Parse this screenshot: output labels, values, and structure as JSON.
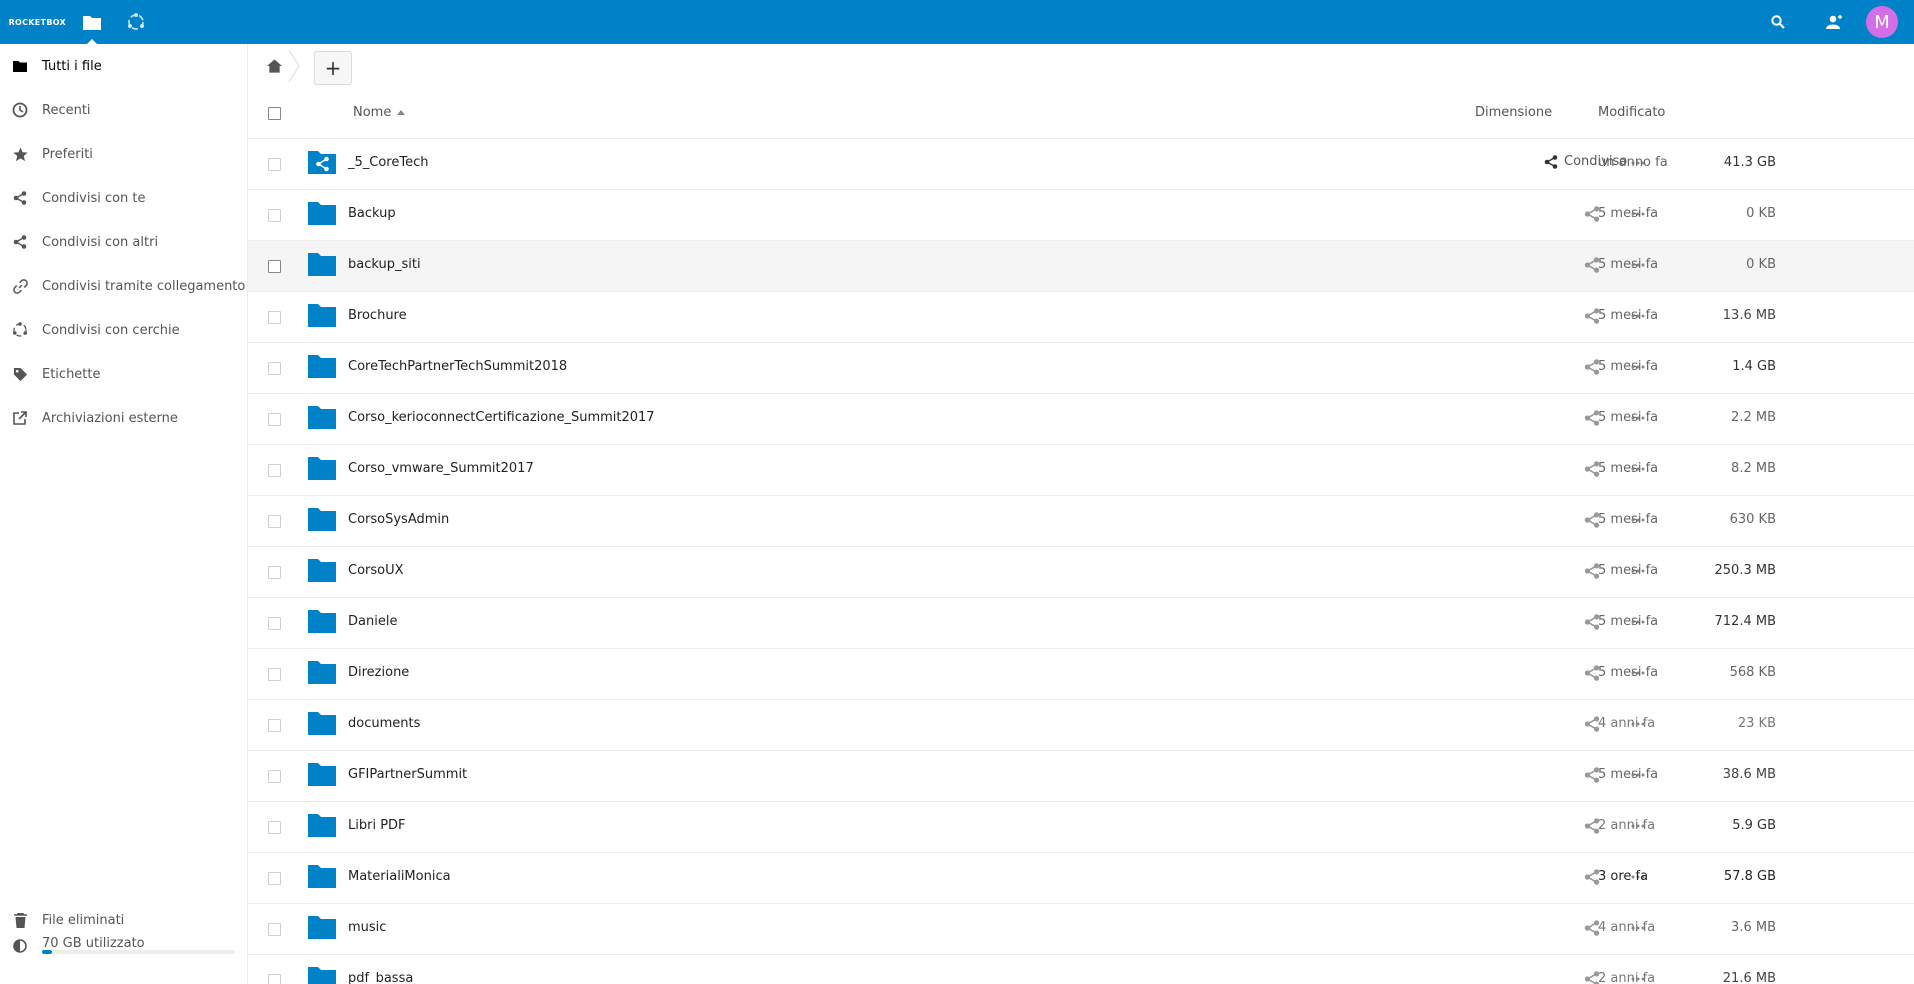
{
  "header": {
    "logo_text": "ROCKETBOX",
    "avatar_initial": "M",
    "brand_color": "#0082c9",
    "icons": [
      "folder-icon",
      "circles-icon",
      "search-icon",
      "contacts-icon"
    ]
  },
  "sidebar": {
    "items": [
      {
        "label": "Tutti i file",
        "icon": "folder-icon"
      },
      {
        "label": "Recenti",
        "icon": "clock-icon"
      },
      {
        "label": "Preferiti",
        "icon": "star-icon"
      },
      {
        "label": "Condivisi con te",
        "icon": "share-icon"
      },
      {
        "label": "Condivisi con altri",
        "icon": "share-icon"
      },
      {
        "label": "Condivisi tramite collegamento",
        "icon": "link-icon"
      },
      {
        "label": "Condivisi con cerchie",
        "icon": "circles-icon"
      },
      {
        "label": "Etichette",
        "icon": "tag-icon"
      },
      {
        "label": "Archiviazioni esterne",
        "icon": "external-icon"
      }
    ],
    "trash_label": "File eliminati",
    "quota_label": "70 GB utilizzato",
    "quota_fraction": 0.05
  },
  "table": {
    "columns": {
      "name": "Nome",
      "size": "Dimensione",
      "modified": "Modificato"
    },
    "shared_label": "Condiviso",
    "rows": [
      {
        "name": "_5_CoreTech",
        "size": "41.3 GB",
        "modified": "un anno fa",
        "shared": true
      },
      {
        "name": "Backup",
        "size": "0 KB",
        "modified": "5 mesi fa"
      },
      {
        "name": "backup_siti",
        "size": "0 KB",
        "modified": "5 mesi fa"
      },
      {
        "name": "Brochure",
        "size": "13.6 MB",
        "modified": "5 mesi fa"
      },
      {
        "name": "CoreTechPartnerTechSummit2018",
        "size": "1.4 GB",
        "modified": "5 mesi fa"
      },
      {
        "name": "Corso_kerioconnectCertificazione_Summit2017",
        "size": "2.2 MB",
        "modified": "5 mesi fa"
      },
      {
        "name": "Corso_vmware_Summit2017",
        "size": "8.2 MB",
        "modified": "5 mesi fa"
      },
      {
        "name": "CorsoSysAdmin",
        "size": "630 KB",
        "modified": "5 mesi fa"
      },
      {
        "name": "CorsoUX",
        "size": "250.3 MB",
        "modified": "5 mesi fa"
      },
      {
        "name": "Daniele",
        "size": "712.4 MB",
        "modified": "5 mesi fa"
      },
      {
        "name": "Direzione",
        "size": "568 KB",
        "modified": "5 mesi fa"
      },
      {
        "name": "documents",
        "size": "23 KB",
        "modified": "4 anni fa"
      },
      {
        "name": "GFIPartnerSummit",
        "size": "38.6 MB",
        "modified": "5 mesi fa"
      },
      {
        "name": "Libri PDF",
        "size": "5.9 GB",
        "modified": "2 anni fa"
      },
      {
        "name": "MaterialiMonica",
        "size": "57.8 GB",
        "modified": "3 ore fa"
      },
      {
        "name": "music",
        "size": "3.6 MB",
        "modified": "4 anni fa"
      },
      {
        "name": "pdf_bassa",
        "size": "21.6 MB",
        "modified": "2 anni fa"
      }
    ]
  }
}
